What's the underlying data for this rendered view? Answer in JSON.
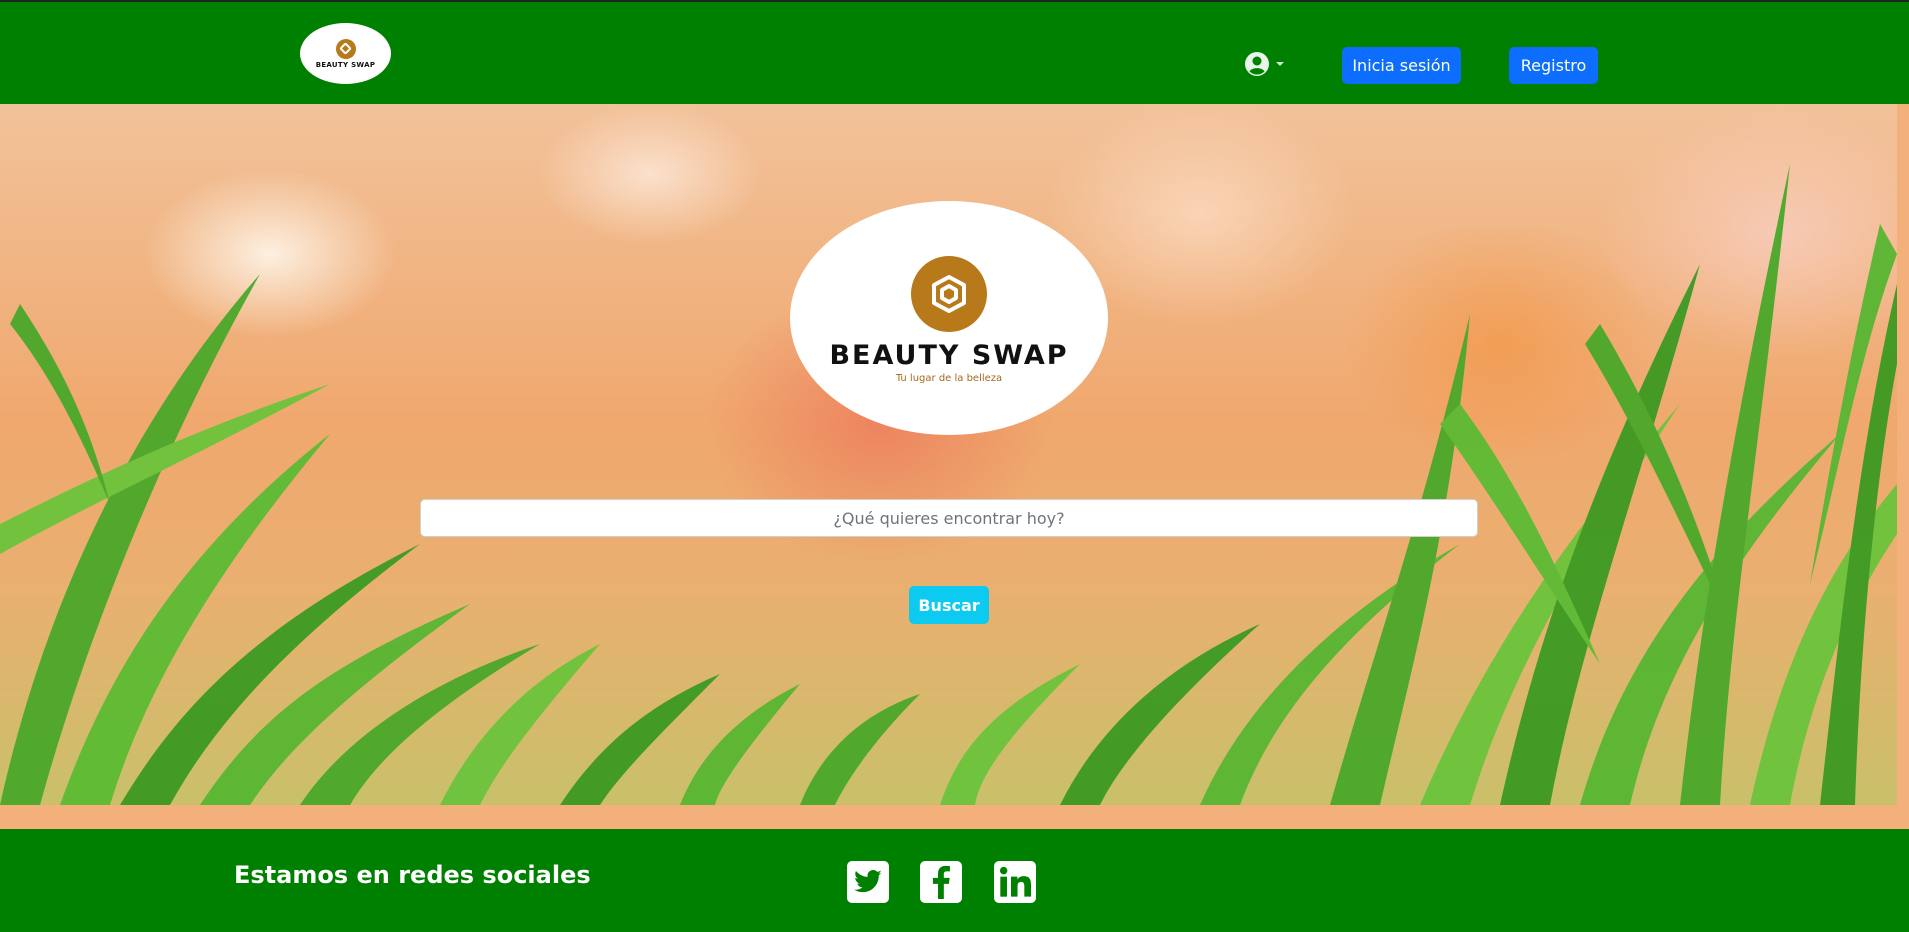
{
  "header": {
    "logo_text": "BEAUTY SWAP",
    "user_menu_icon": "user-circle-icon",
    "login_label": "Inicia sesión",
    "register_label": "Registro"
  },
  "hero": {
    "brand": "BEAUTY SWAP",
    "tagline": "Tu lugar de la belleza",
    "search": {
      "placeholder": "¿Qué quieres encontrar hoy?",
      "value": ""
    },
    "search_button": "Buscar"
  },
  "footer": {
    "title": "Estamos en redes sociales",
    "social_icons": [
      "twitter-icon",
      "facebook-icon",
      "linkedin-icon"
    ]
  },
  "colors": {
    "nav_green": "#008000",
    "primary_blue": "#0d6efd",
    "info_cyan": "#0dcaf0",
    "logo_gold": "#b8791a"
  }
}
